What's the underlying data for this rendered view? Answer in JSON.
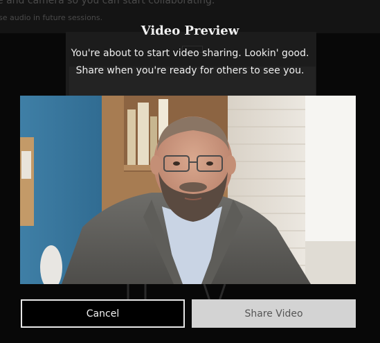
{
  "background": {
    "line1": "e and camera so you can start collaborating.",
    "line2": "se audio in future sessions."
  },
  "modal": {
    "title": "Video Preview",
    "description_line1": "You're about to start video sharing. Lookin' good.",
    "description_line2": "Share when you're ready for others to see you.",
    "cancel_label": "Cancel",
    "share_label": "Share Video"
  },
  "colors": {
    "overlay": "#080808",
    "cancel_border": "#e8e8e8",
    "share_bg": "#d3d3d3",
    "share_text": "#555555"
  }
}
